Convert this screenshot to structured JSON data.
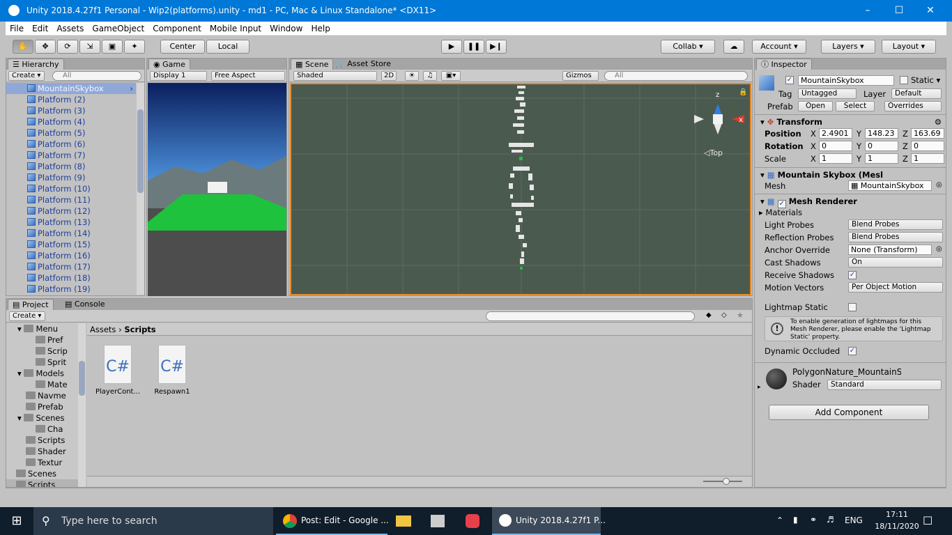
{
  "window": {
    "title": "Unity 2018.4.27f1 Personal - Wip2(platforms).unity - md1 - PC, Mac & Linux Standalone* <DX11>"
  },
  "menubar": [
    "File",
    "Edit",
    "Assets",
    "GameObject",
    "Component",
    "Mobile Input",
    "Window",
    "Help"
  ],
  "toolbar": {
    "pivot_center": "Center",
    "pivot_local": "Local",
    "collab": "Collab",
    "account": "Account",
    "layers": "Layers",
    "layout": "Layout"
  },
  "hierarchy": {
    "tab": "Hierarchy",
    "create": "Create",
    "search_placeholder": "All",
    "items": [
      "MountainSkybox",
      "Platform (2)",
      "Platform (3)",
      "Platform (4)",
      "Platform (5)",
      "Platform (6)",
      "Platform (7)",
      "Platform (8)",
      "Platform (9)",
      "Platform (10)",
      "Platform (11)",
      "Platform (12)",
      "Platform (13)",
      "Platform (14)",
      "Platform (15)",
      "Platform (16)",
      "Platform (17)",
      "Platform (18)",
      "Platform (19)"
    ]
  },
  "game": {
    "tab": "Game",
    "display": "Display 1",
    "aspect": "Free Aspect"
  },
  "scene": {
    "tab": "Scene",
    "asset_store_tab": "Asset Store",
    "shading": "Shaded",
    "mode_2d": "2D",
    "gizmos": "Gizmos",
    "search_placeholder": "All",
    "gizmo_label": "Top",
    "axis_x": "x",
    "axis_z": "z"
  },
  "inspector": {
    "tab": "Inspector",
    "object_name": "MountainSkybox",
    "static_label": "Static",
    "tag_label": "Tag",
    "tag_value": "Untagged",
    "layer_label": "Layer",
    "layer_value": "Default",
    "prefab_label": "Prefab",
    "prefab_open": "Open",
    "prefab_select": "Select",
    "prefab_overrides": "Overrides",
    "transform": {
      "title": "Transform",
      "position_label": "Position",
      "position": {
        "x": "2.4901",
        "y": "148.23",
        "z": "163.69"
      },
      "rotation_label": "Rotation",
      "rotation": {
        "x": "0",
        "y": "0",
        "z": "0"
      },
      "scale_label": "Scale",
      "scale": {
        "x": "1",
        "y": "1",
        "z": "1"
      },
      "axis_x": "X",
      "axis_y": "Y",
      "axis_z": "Z"
    },
    "mesh_filter": {
      "title": "Mountain Skybox (Mesl",
      "mesh_label": "Mesh",
      "mesh_value": "MountainSkybox"
    },
    "mesh_renderer": {
      "title": "Mesh Renderer",
      "materials": "Materials",
      "light_probes_label": "Light Probes",
      "light_probes": "Blend Probes",
      "reflection_probes_label": "Reflection Probes",
      "reflection_probes": "Blend Probes",
      "anchor_override_label": "Anchor Override",
      "anchor_override": "None (Transform)",
      "cast_shadows_label": "Cast Shadows",
      "cast_shadows": "On",
      "receive_shadows_label": "Receive Shadows",
      "motion_vectors_label": "Motion Vectors",
      "motion_vectors": "Per Object Motion",
      "lightmap_static_label": "Lightmap Static",
      "info": "To enable generation of lightmaps for this Mesh Renderer, please enable the 'Lightmap Static' property.",
      "dynamic_occluded_label": "Dynamic Occluded"
    },
    "material": {
      "name": "PolygonNature_MountainS",
      "shader_label": "Shader",
      "shader": "Standard"
    },
    "add_component": "Add Component"
  },
  "project": {
    "tab": "Project",
    "console_tab": "Console",
    "create": "Create",
    "tree": [
      {
        "label": "Menu",
        "indent": 2,
        "arrow": true
      },
      {
        "label": "Pref",
        "indent": 3,
        "arrow": false
      },
      {
        "label": "Scrip",
        "indent": 3,
        "arrow": false
      },
      {
        "label": "Sprit",
        "indent": 3,
        "arrow": false
      },
      {
        "label": "Models",
        "indent": 2,
        "arrow": true
      },
      {
        "label": "Mate",
        "indent": 3,
        "arrow": false
      },
      {
        "label": "Navme",
        "indent": 2,
        "arrow": false
      },
      {
        "label": "Prefab",
        "indent": 2,
        "arrow": false
      },
      {
        "label": "Scenes",
        "indent": 2,
        "arrow": true
      },
      {
        "label": "Cha",
        "indent": 3,
        "arrow": false
      },
      {
        "label": "Scripts",
        "indent": 2,
        "arrow": false
      },
      {
        "label": "Shader",
        "indent": 2,
        "arrow": false
      },
      {
        "label": "Textur",
        "indent": 2,
        "arrow": false
      },
      {
        "label": "Scenes",
        "indent": 1,
        "arrow": false
      },
      {
        "label": "Scripts",
        "indent": 1,
        "arrow": false
      }
    ],
    "breadcrumb": {
      "root": "Assets",
      "current": "Scripts"
    },
    "assets": [
      {
        "name": "PlayerCont...",
        "glyph": "C#"
      },
      {
        "name": "Respawn1",
        "glyph": "C#"
      }
    ]
  },
  "taskbar": {
    "search_placeholder": "Type here to search",
    "chrome_task": "Post: Edit - Google ...",
    "unity_task": "Unity 2018.4.27f1 P...",
    "lang": "ENG",
    "time": "17:11",
    "date": "18/11/2020"
  },
  "colors": {
    "accent": "#0078d7",
    "selection": "#8fa8d8",
    "ground": "#1ec23c",
    "scene_bg": "#4a5a4f"
  }
}
